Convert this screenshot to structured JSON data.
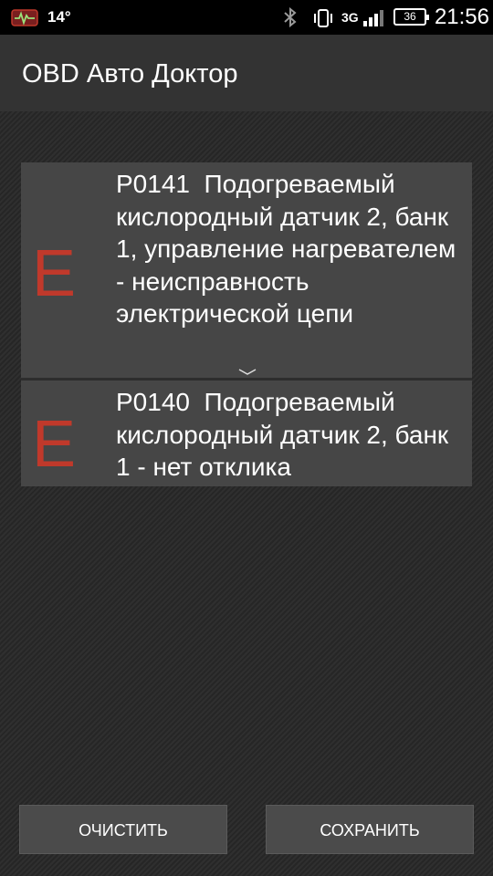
{
  "status_bar": {
    "temperature": "14°",
    "network": "3G",
    "battery": "36",
    "time": "21:56"
  },
  "action_bar": {
    "title": "OBD Авто Доктор"
  },
  "dtc_list": [
    {
      "severity": "E",
      "text": "P0141  Подогреваемый кислородный датчик 2, банк 1, управление нагревателем - неисправность электрической цепи"
    },
    {
      "severity": "E",
      "text": "P0140  Подогреваемый кислородный датчик 2, банк 1 - нет отклика"
    }
  ],
  "buttons": {
    "clear_label": "ОЧИСТИТЬ",
    "save_label": "СОХРАНИТЬ"
  },
  "colors": {
    "severity_error": "#c0392b",
    "item_background": "#464646"
  }
}
